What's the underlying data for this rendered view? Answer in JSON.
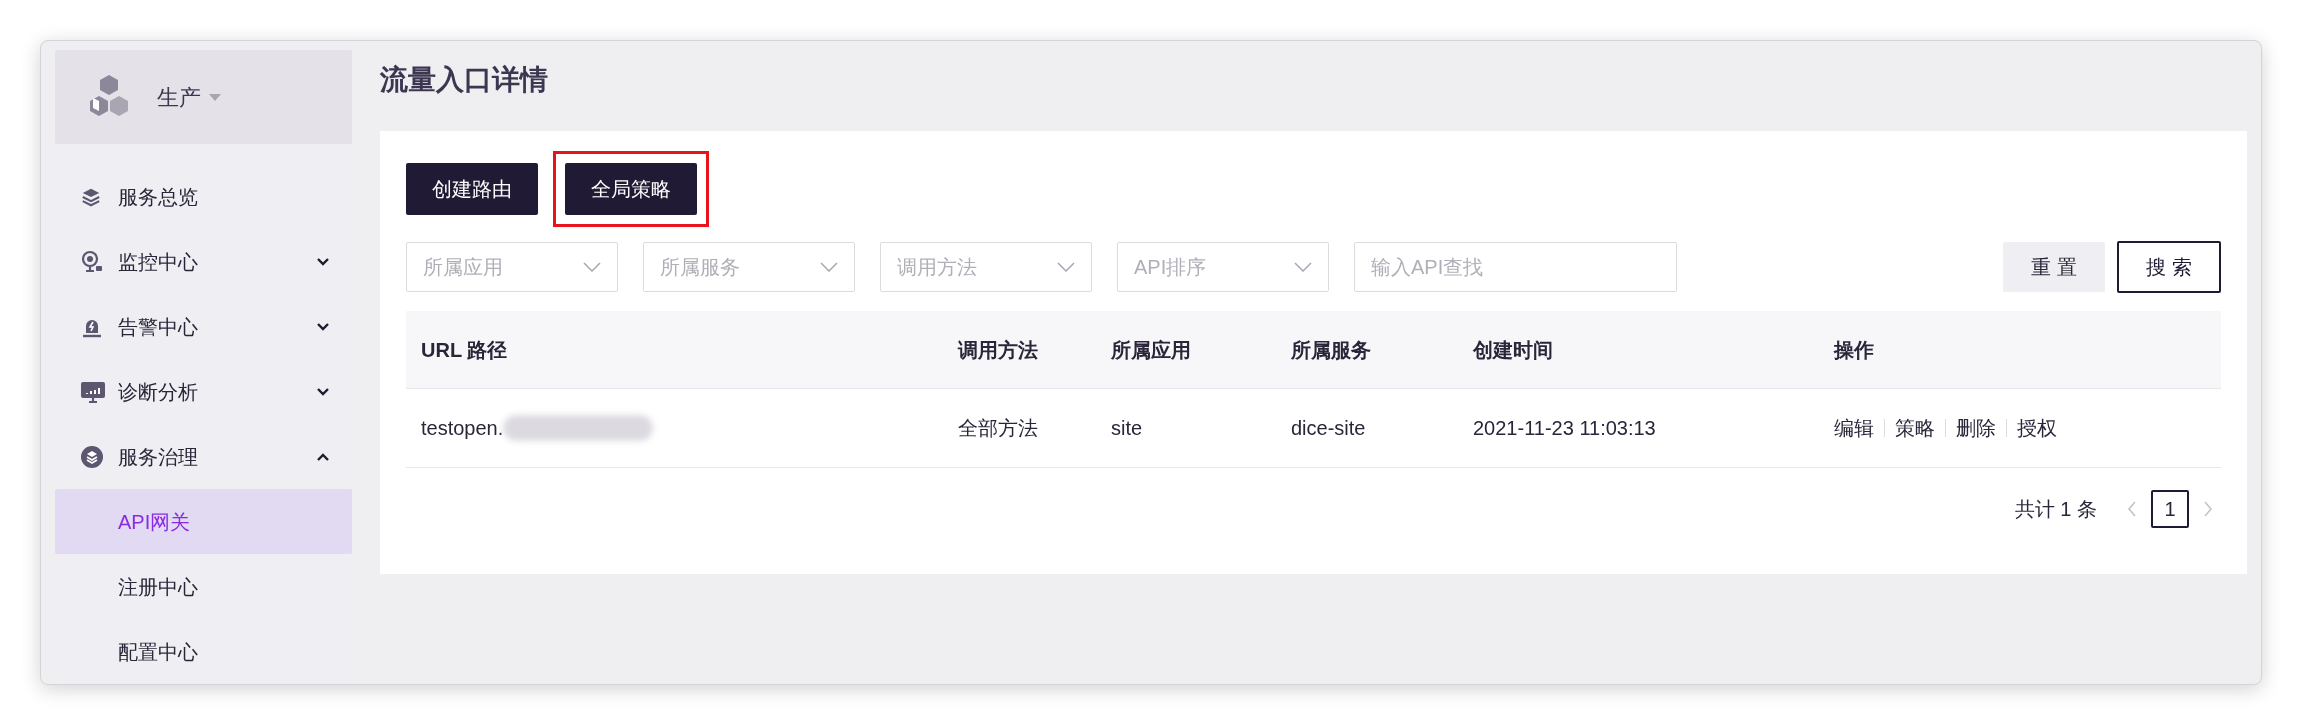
{
  "sidebar": {
    "env": {
      "label": "生产"
    },
    "items": [
      {
        "kind": "link",
        "label": "服务总览",
        "selected": false
      },
      {
        "kind": "group",
        "label": "监控中心",
        "expanded": false,
        "selected": false
      },
      {
        "kind": "group",
        "label": "告警中心",
        "expanded": false,
        "selected": false
      },
      {
        "kind": "group",
        "label": "诊断分析",
        "expanded": false,
        "selected": false
      },
      {
        "kind": "group",
        "label": "服务治理",
        "expanded": true,
        "selected": false,
        "children": [
          {
            "label": "API网关",
            "selected": true
          },
          {
            "label": "注册中心",
            "selected": false
          },
          {
            "label": "配置中心",
            "selected": false
          }
        ]
      }
    ]
  },
  "page": {
    "title": "流量入口详情",
    "buttons": [
      {
        "label": "创建路由",
        "highlighted": false
      },
      {
        "label": "全局策略",
        "highlighted": true
      }
    ],
    "filters": [
      {
        "kind": "select",
        "placeholder": "所属应用"
      },
      {
        "kind": "select",
        "placeholder": "所属服务"
      },
      {
        "kind": "select",
        "placeholder": "调用方法"
      },
      {
        "kind": "select",
        "placeholder": "API排序"
      },
      {
        "kind": "input",
        "placeholder": "输入API查找"
      }
    ],
    "reset_button": "重 置",
    "search_button": "搜 索",
    "table": {
      "columns": [
        "URL 路径",
        "调用方法",
        "所属应用",
        "所属服务",
        "创建时间",
        "操作"
      ],
      "rows": [
        {
          "url": "testopen.",
          "url_blurred": true,
          "method": "全部方法",
          "app": "site",
          "service": "dice-site",
          "created": "2021-11-23 11:03:13",
          "actions": [
            "编辑",
            "策略",
            "删除",
            "授权"
          ]
        }
      ]
    },
    "pagination": {
      "total": "共计 1 条",
      "pages": [
        {
          "label": "1",
          "selected": true
        }
      ]
    }
  }
}
